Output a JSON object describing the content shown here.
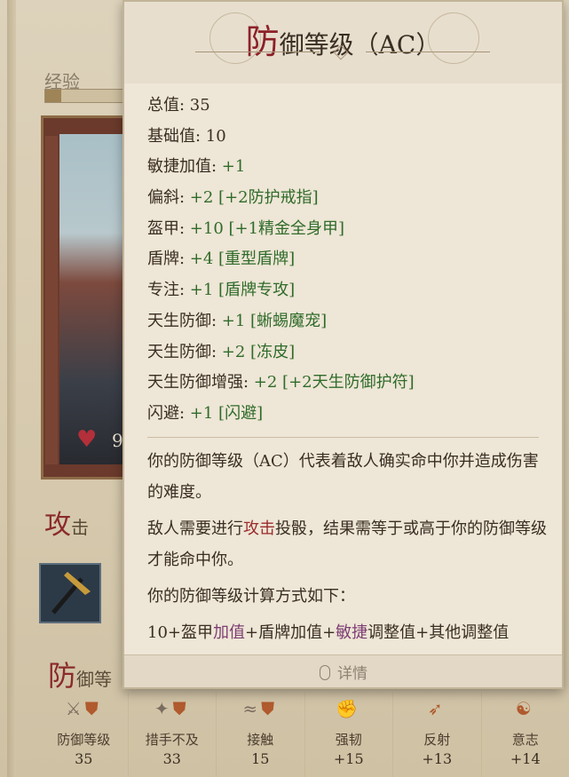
{
  "background": {
    "experience_label": "经验",
    "experience_progress": 0.2,
    "hp_value": "9",
    "attack_tab": {
      "first_char": "攻",
      "rest": "击"
    },
    "defense_tab": {
      "first_char": "防",
      "rest": "御等"
    }
  },
  "tooltip": {
    "title_first": "防",
    "title_rest": "御等级（AC）",
    "stats": [
      {
        "label": "总值: ",
        "value": "35",
        "value_plain": true
      },
      {
        "label": "基础值: ",
        "value": "10",
        "value_plain": true
      },
      {
        "label": "敏捷加值: ",
        "value": "+1"
      },
      {
        "label": "偏斜: ",
        "value": "+2 [+2防护戒指]"
      },
      {
        "label": "盔甲: ",
        "value": "+10 [+1精金全身甲]"
      },
      {
        "label": "盾牌: ",
        "value": "+4 [重型盾牌]"
      },
      {
        "label": "专注: ",
        "value": "+1 [盾牌专攻]"
      },
      {
        "label": "天生防御: ",
        "value": "+1 [蜥蜴魔宠]"
      },
      {
        "label": "天生防御: ",
        "value": "+2 [冻皮]"
      },
      {
        "label": "天生防御增强: ",
        "value": "+2 [+2天生防御护符]"
      },
      {
        "label": "闪避: ",
        "value": "+1 [闪避]"
      }
    ],
    "desc1": "你的防御等级（AC）代表着敌人确实命中你并造成伤害的难度。",
    "desc2_a": "敌人需要进行",
    "desc2_kw": "攻击",
    "desc2_b": "投骰，结果需等于或高于你的防御等级才能命中你。",
    "desc3": "你的防御等级计算方式如下：",
    "formula_a": "10+盔甲",
    "formula_kw1": "加值",
    "formula_b": "+盾牌加值+",
    "formula_kw2": "敏捷",
    "formula_c": "调整值+其他调整值",
    "footer_label": "详情"
  },
  "stats_bar": [
    {
      "label": "防御等级",
      "value": "35",
      "icon": "armor-icon"
    },
    {
      "label": "措手不及",
      "value": "33",
      "icon": "flatfooted-icon"
    },
    {
      "label": "接触",
      "value": "15",
      "icon": "touch-icon"
    },
    {
      "label": "强韧",
      "value": "+15",
      "icon": "fortitude-icon"
    },
    {
      "label": "反射",
      "value": "+13",
      "icon": "reflex-icon"
    },
    {
      "label": "意志",
      "value": "+14",
      "icon": "will-icon"
    }
  ],
  "colors": {
    "accent_red": "#8c2128",
    "bonus_green": "#2f6b2a",
    "keyword_purple": "#7d3d73"
  }
}
